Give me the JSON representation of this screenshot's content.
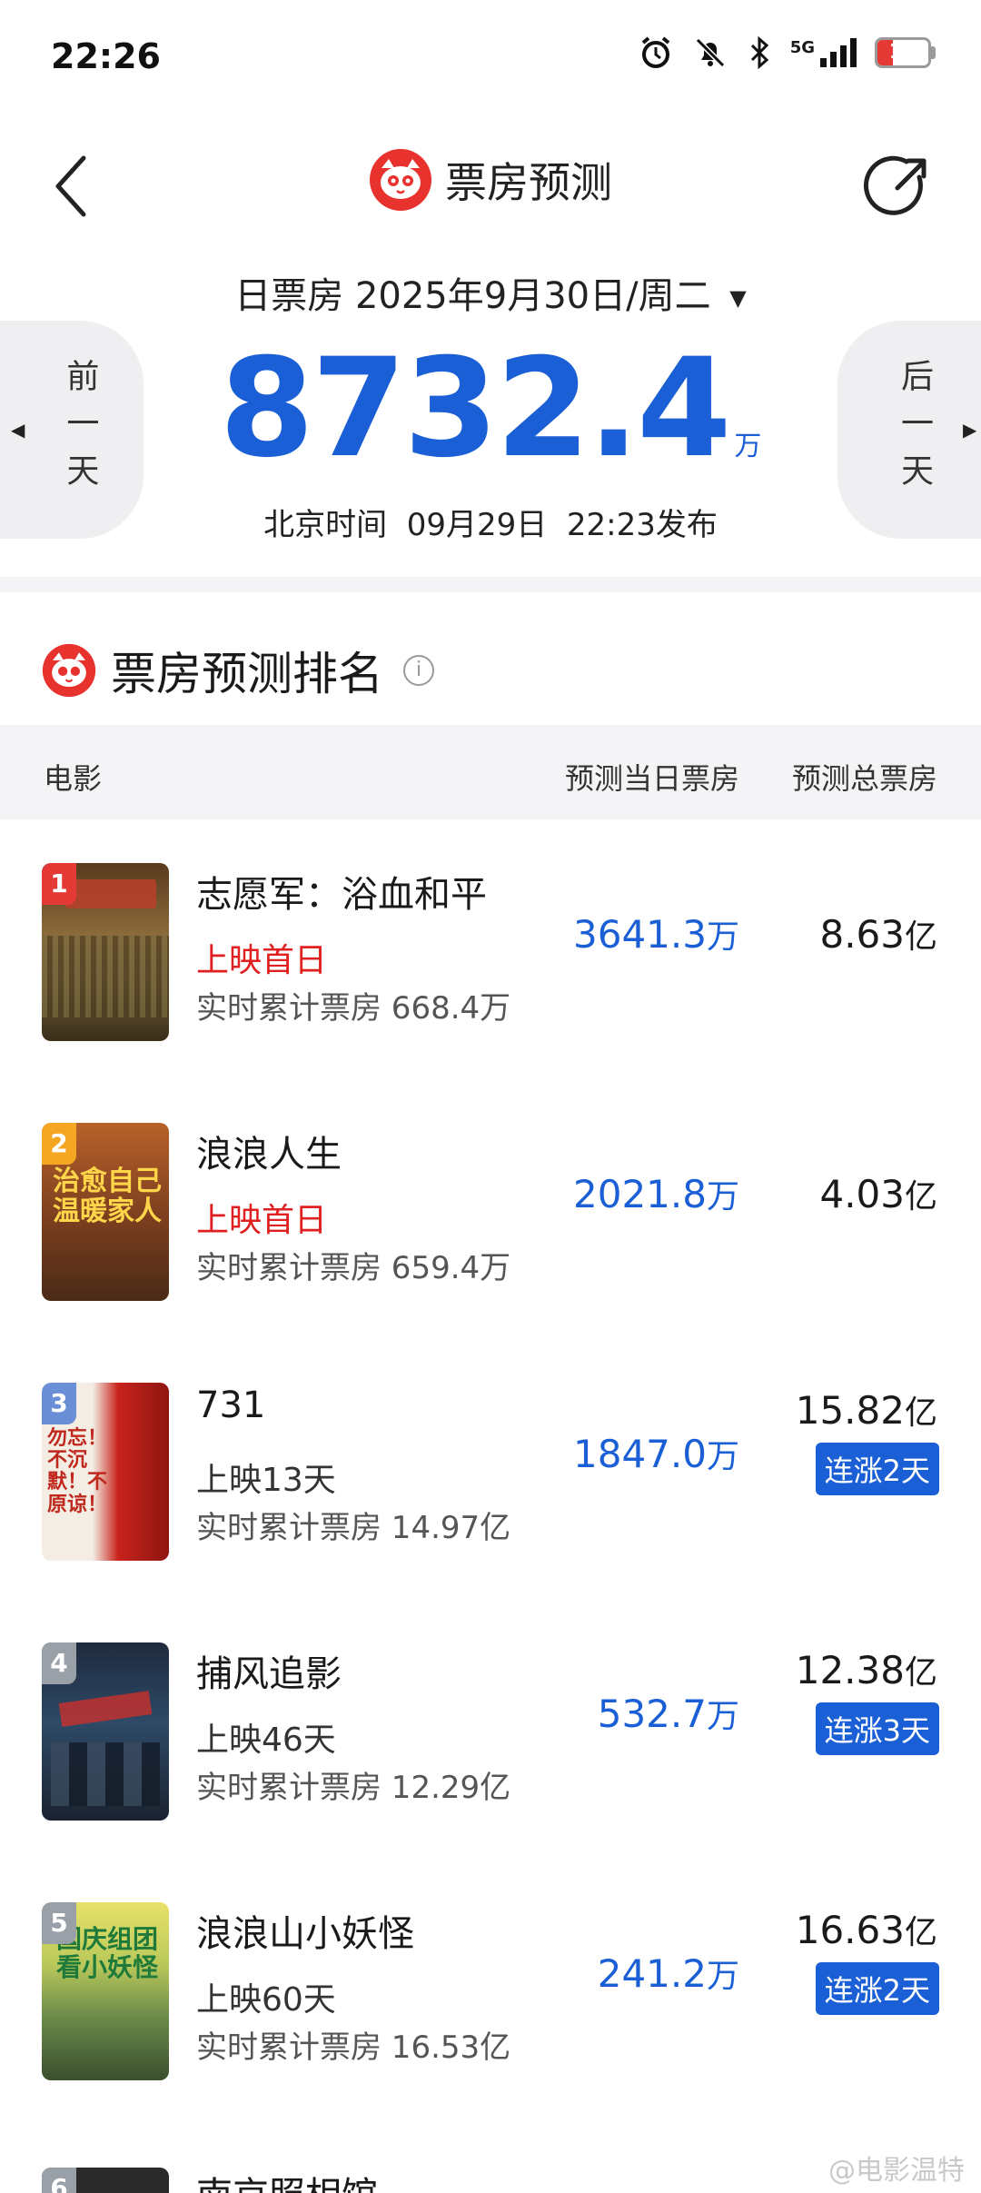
{
  "status_bar": {
    "time": "22:26",
    "network": "5G",
    "battery": "17",
    "icons": [
      "alarm-icon",
      "bell-off-icon",
      "bluetooth-icon",
      "signal-icon",
      "battery-icon"
    ]
  },
  "header": {
    "title": "票房预测",
    "logo": "maoyan-cat-logo",
    "back_icon": "chevron-left-icon",
    "share_icon": "share-icon"
  },
  "summary": {
    "date_prefix": "日票房",
    "date_value": "2025年9月30日/周二",
    "prev_day_label": "前一天",
    "next_day_label": "后一天",
    "total_value": "8732.4",
    "total_unit": "万",
    "publish_text": "北京时间  09月29日  22:23发布"
  },
  "ranking": {
    "title": "票房预测排名",
    "columns": {
      "film": "电影",
      "daily": "预测当日票房",
      "total": "预测总票房"
    },
    "movies": [
      {
        "rank": "1",
        "title": "志愿军：浴血和平",
        "status": "上映首日",
        "cumulative": "实时累计票房 668.4万",
        "daily_value": "3641.3",
        "daily_unit": "万",
        "total_value": "8.63",
        "total_unit": "亿",
        "trend": ""
      },
      {
        "rank": "2",
        "title": "浪浪人生",
        "status": "上映首日",
        "cumulative": "实时累计票房 659.4万",
        "daily_value": "2021.8",
        "daily_unit": "万",
        "total_value": "4.03",
        "total_unit": "亿",
        "trend": "",
        "poster_text": "治愈自己 温暖家人"
      },
      {
        "rank": "3",
        "title": "731",
        "status": "上映13天",
        "cumulative": "实时累计票房 14.97亿",
        "daily_value": "1847.0",
        "daily_unit": "万",
        "total_value": "15.82",
        "total_unit": "亿",
        "trend": "连涨2天",
        "poster_text": "勿忘！不沉默！不原谅！"
      },
      {
        "rank": "4",
        "title": "捕风追影",
        "status": "上映46天",
        "cumulative": "实时累计票房 12.29亿",
        "daily_value": "532.7",
        "daily_unit": "万",
        "total_value": "12.38",
        "total_unit": "亿",
        "trend": "连涨3天"
      },
      {
        "rank": "5",
        "title": "浪浪山小妖怪",
        "status": "上映60天",
        "cumulative": "实时累计票房 16.53亿",
        "daily_value": "241.2",
        "daily_unit": "万",
        "total_value": "16.63",
        "total_unit": "亿",
        "trend": "连涨2天",
        "poster_text": "国庆组团 看小妖怪"
      }
    ],
    "partial_movie": {
      "rank": "6",
      "title": "南京照相馆"
    }
  },
  "watermark": "@电影温特",
  "colors": {
    "accent_blue": "#1a5fd6",
    "status_red": "#e02020",
    "brand_red": "#e8322e"
  }
}
